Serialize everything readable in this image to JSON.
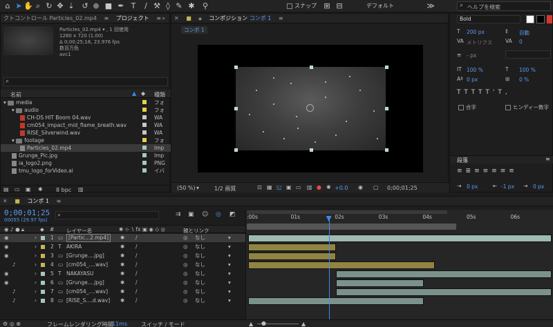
{
  "toolbar": {
    "snap_label": "スナップ",
    "workspace": "デフォルト",
    "search_placeholder": "ヘルプを検索"
  },
  "project_panel": {
    "tab_effects": "クトコントロール Particles_02.mp4",
    "tab_project": "プロジェクト",
    "selected_name": "Particles_02.mp4 ▾ , 1 回使用",
    "selected_size": "1280 x 720 (1.00)",
    "selected_duration": "Δ 0;00;25;18, 23.976 fps",
    "selected_colors": "数百万色",
    "selected_codec": "avc1",
    "col_name": "名前",
    "col_type": "種類",
    "bpc": "8 bpc",
    "items": [
      {
        "name": "media",
        "type": "フォ",
        "kind": "folder",
        "color": "#e5d24a"
      },
      {
        "name": "audio",
        "type": "フォ",
        "kind": "folder",
        "color": "#e5d24a"
      },
      {
        "name": "CH-DS HIT Boom 04.wav",
        "type": "WA",
        "kind": "wav",
        "color": "#c8c8c8"
      },
      {
        "name": "cm054_impact_mid_flame_breath.wav",
        "type": "WA",
        "kind": "wav",
        "color": "#c8c8c8"
      },
      {
        "name": "RISE_Silverwind.wav",
        "type": "WA",
        "kind": "wav",
        "color": "#c8c8c8"
      },
      {
        "name": "footage",
        "type": "フォ",
        "kind": "folder",
        "color": "#e5d24a"
      },
      {
        "name": "Particles_02.mp4",
        "type": "Imp",
        "kind": "mp4",
        "color": "#a7c7c0"
      },
      {
        "name": "Grunge_Pic.jpg",
        "type": "Imp",
        "kind": "pic",
        "color": "#a7c7c0"
      },
      {
        "name": "ia_logo2.png",
        "type": "PNG",
        "kind": "pic",
        "color": "#a7c7c0"
      },
      {
        "name": "tmu_logo_forVideo.ai",
        "type": "イバ",
        "kind": "pic",
        "color": "#a7c7c0"
      }
    ]
  },
  "comp_panel": {
    "tab_title": "コンポジション",
    "tab_comp": "コンポ 1",
    "sub_tab": "コンポ 1",
    "zoom": "(50 %)",
    "quality": "1/2 画質",
    "exposure": "+0.0",
    "timecode": "0;00;01;25"
  },
  "character_panel": {
    "font_style": "Bold",
    "font_size": "200 px",
    "leading": "自動",
    "kerning": "メトリクス",
    "tracking": "0",
    "stroke": "- px",
    "vert_scale": "100 %",
    "horiz_scale": "100 %",
    "baseline": "0 px",
    "tsume": "0 %",
    "ligature": "合字",
    "hindi": "ヒンディー数字",
    "paragraph": "段落",
    "indent_left": "0 px",
    "indent_right": "-1 px",
    "indent_first": "0 px"
  },
  "timeline": {
    "tab": "コンポ 1",
    "timecode": "0;00;01;25",
    "frames": "00055 (29.97 fps)",
    "col_layer": "レイヤー名",
    "col_parent": "親とリンク",
    "ticks": [
      ":00s",
      "01s",
      "02s",
      "03s",
      "04s",
      "05s",
      "06s"
    ],
    "render_label": "フレームレンダリング時間",
    "render_ms": "11ms",
    "switch_label": "スイッチ / モード",
    "layers": [
      {
        "num": "1",
        "name": "[Partic...2.mp4]",
        "parent": "なし",
        "color": "#a7c7c0",
        "type": "video",
        "start": 0.0,
        "end": 7.0
      },
      {
        "num": "2",
        "name": "AKIRA",
        "parent": "なし",
        "color": "#c8b453",
        "type": "text",
        "start": 0.0,
        "end": 2.0
      },
      {
        "num": "3",
        "name": "[Grunge....jpg]",
        "parent": "なし",
        "color": "#c8b453",
        "type": "pic",
        "start": 0.0,
        "end": 2.0
      },
      {
        "num": "4",
        "name": "[cm054_....wav]",
        "parent": "なし",
        "color": "#c8b453",
        "type": "audio",
        "start": 0.0,
        "end": 4.25
      },
      {
        "num": "5",
        "name": "NAKAYASU",
        "parent": "なし",
        "color": "#a7c7c0",
        "type": "text",
        "start": 2.0,
        "end": 7.0
      },
      {
        "num": "6",
        "name": "[Grunge....jpg]",
        "parent": "なし",
        "color": "#a7c7c0",
        "type": "pic",
        "start": 2.0,
        "end": 4.0
      },
      {
        "num": "7",
        "name": "[cm054_....wav]",
        "parent": "なし",
        "color": "#a7c7c0",
        "type": "audio",
        "start": 2.0,
        "end": 7.0
      },
      {
        "num": "8",
        "name": "[RISE_S....d.wav]",
        "parent": "なし",
        "color": "#a7c7c0",
        "type": "audio",
        "start": 0.0,
        "end": 4.0
      }
    ]
  }
}
